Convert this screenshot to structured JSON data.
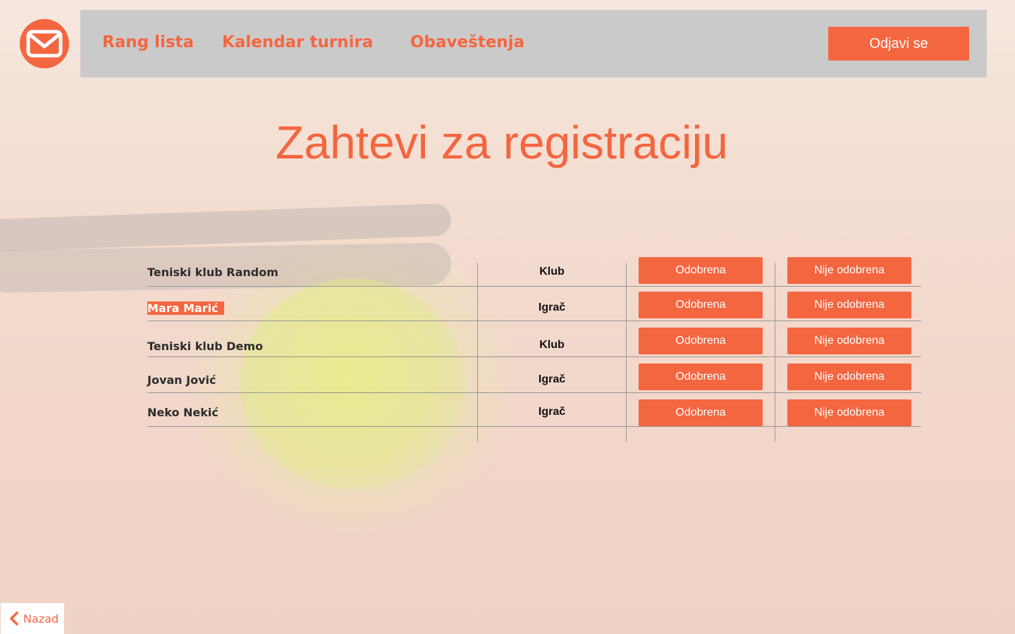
{
  "nav": {
    "links": [
      "Rang lista",
      "Kalendar turnira",
      "Obaveštenja"
    ],
    "logout_label": "Odjavi se",
    "logo_icon": "envelope-icon"
  },
  "page": {
    "title": "Zahtevi za registraciju"
  },
  "requests": [
    {
      "name": "Teniski klub Random",
      "type": "Klub",
      "highlighted": false
    },
    {
      "name": "Mara Marić",
      "type": "Igrač",
      "highlighted": true
    },
    {
      "name": "Teniski klub Demo",
      "type": "Klub",
      "highlighted": false
    },
    {
      "name": "Jovan Jović",
      "type": "Igrač",
      "highlighted": false
    },
    {
      "name": "Neko Nekić",
      "type": "Igrač",
      "highlighted": false
    }
  ],
  "actions": {
    "approve_label": "Odobrena",
    "reject_label": "Nije odobrena"
  },
  "back": {
    "label": "Nazad",
    "icon": "chevron-left-icon"
  },
  "colors": {
    "accent": "#f46640",
    "navbar": "#cbcaca"
  }
}
